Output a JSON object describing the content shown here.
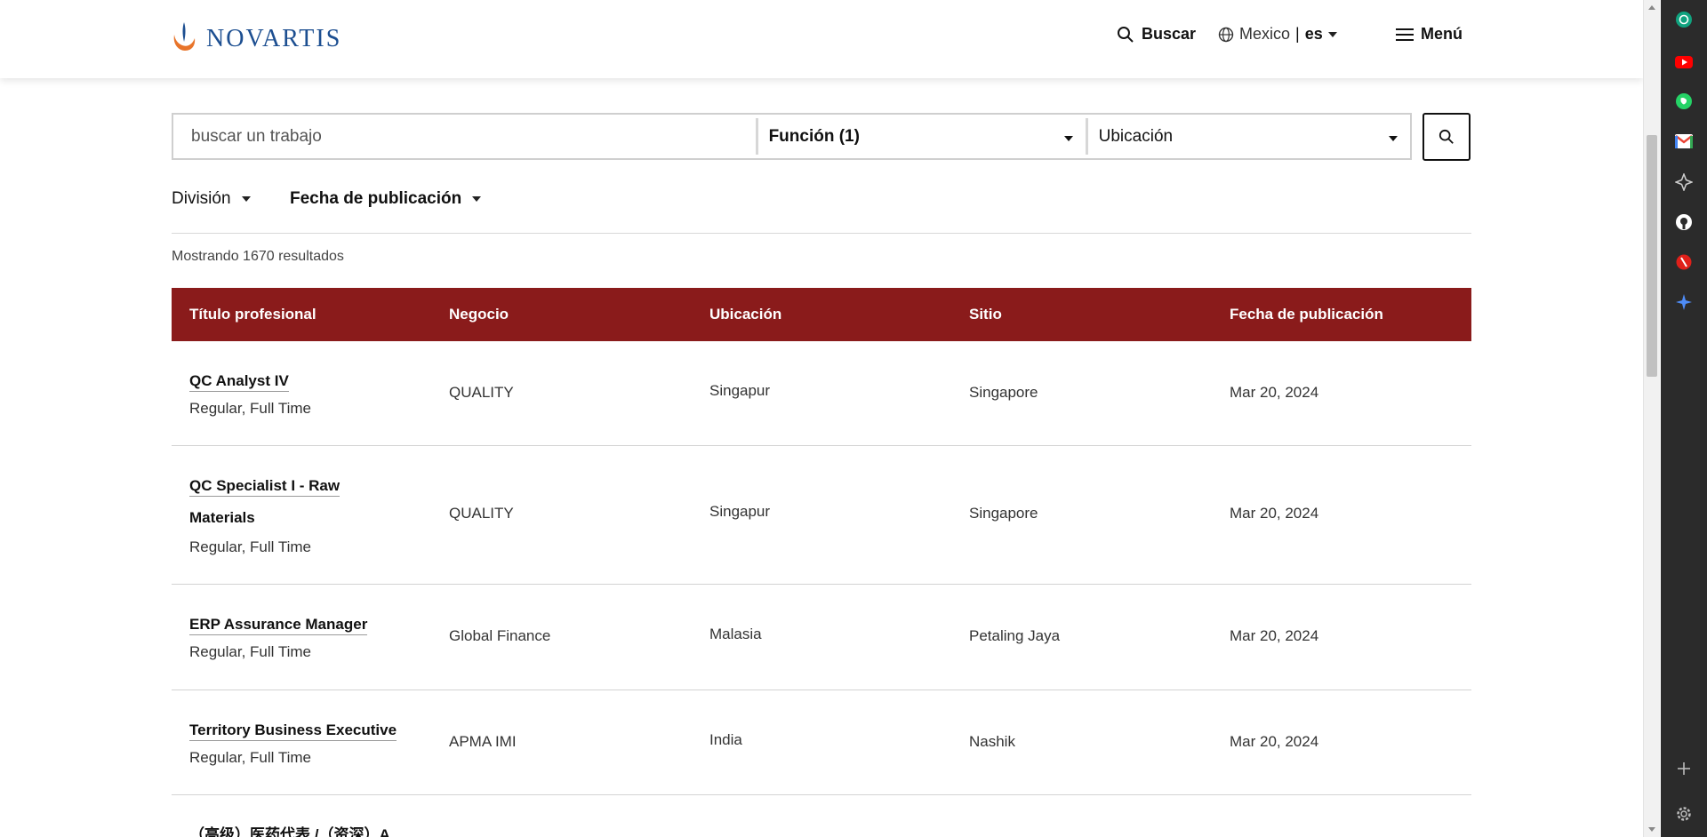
{
  "header": {
    "logo_text": "NOVARTIS",
    "search_label": "Buscar",
    "locale_country": "Mexico",
    "locale_lang": "es",
    "menu_label": "Menú"
  },
  "search": {
    "placeholder": "buscar un trabajo",
    "function_label": "Función (1)",
    "location_label": "Ubicación",
    "button_icon": "search-icon"
  },
  "filters": {
    "division_label": "División",
    "date_label": "Fecha de publicación"
  },
  "results_text": "Mostrando 1670 resultados",
  "table": {
    "headers": [
      "Título profesional",
      "Negocio",
      "Ubicación",
      "Sitio",
      "Fecha de publicación"
    ],
    "rows": [
      {
        "title_lines": [
          "QC Analyst IV"
        ],
        "type": "Regular, Full Time",
        "business": "QUALITY",
        "location": "Singapur",
        "site": "Singapore",
        "date": "Mar 20, 2024"
      },
      {
        "title_lines": [
          "QC Specialist I - Raw",
          "Materials"
        ],
        "type": "Regular, Full Time",
        "business": "QUALITY",
        "location": "Singapur",
        "site": "Singapore",
        "date": "Mar 20, 2024"
      },
      {
        "title_lines": [
          "ERP Assurance Manager"
        ],
        "type": "Regular, Full Time",
        "business": "Global Finance",
        "location": "Malasia",
        "site": "Petaling Jaya",
        "date": "Mar 20, 2024"
      },
      {
        "title_lines": [
          "Territory Business Executive"
        ],
        "type": "Regular, Full Time",
        "business": "APMA IMI",
        "location": "India",
        "site": "Nashik",
        "date": "Mar 20, 2024"
      },
      {
        "title_lines": [
          "（高级）医药代表 /（资深）A"
        ]
      }
    ]
  },
  "sidebar_icons": [
    "chatgpt-icon",
    "youtube-icon",
    "whatsapp-icon",
    "gmail-icon",
    "sparkle-icon",
    "github-icon",
    "shield-icon",
    "star-icon",
    "plus-icon",
    "gear-icon"
  ],
  "colors": {
    "brand_blue": "#1d4f91",
    "table_header": "#8a1b1b",
    "sidebar_bg": "#2b2b2b"
  }
}
